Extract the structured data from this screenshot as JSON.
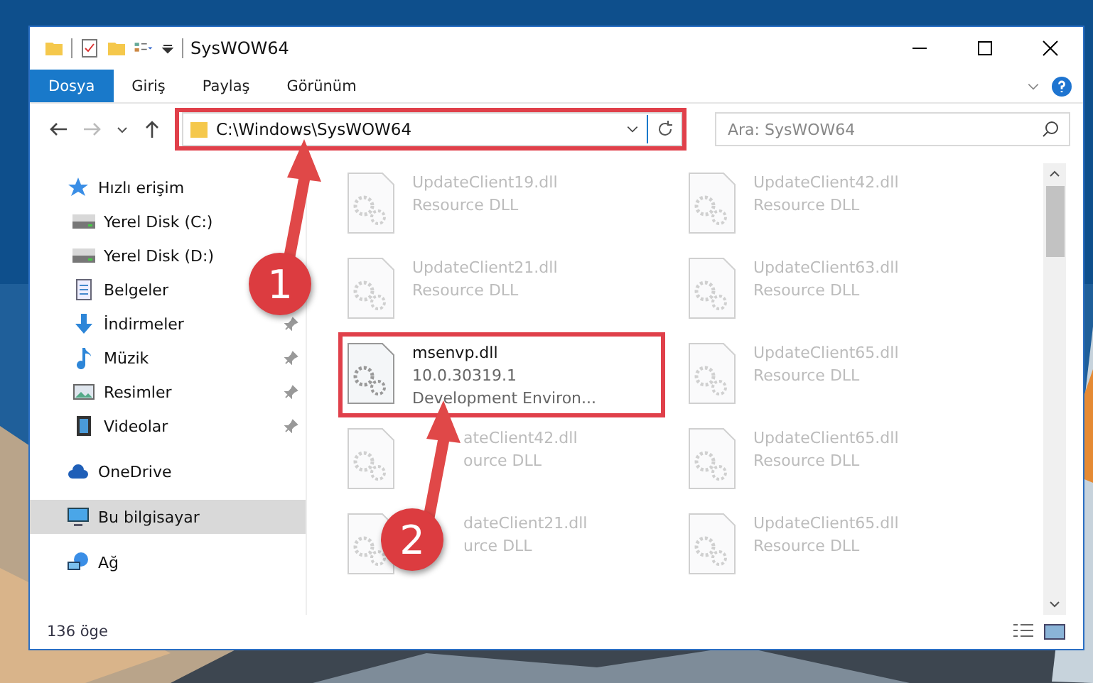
{
  "window": {
    "title": "SysWOW64"
  },
  "ribbon_tabs": [
    {
      "label": "Dosya",
      "selected": true
    },
    {
      "label": "Giriş",
      "selected": false
    },
    {
      "label": "Paylaş",
      "selected": false
    },
    {
      "label": "Görünüm",
      "selected": false
    }
  ],
  "address": {
    "value": "C:\\Windows\\SysWOW64"
  },
  "search": {
    "placeholder": "Ara: SysWOW64"
  },
  "sidebar": {
    "items": [
      {
        "label": "Hızlı erişim",
        "kind": "star",
        "selected": false,
        "children": [
          {
            "label": "Yerel Disk (C:)",
            "kind": "drive",
            "pinned": false,
            "selected": false
          },
          {
            "label": "Yerel Disk (D:)",
            "kind": "drive",
            "pinned": false,
            "selected": false
          },
          {
            "label": "Belgeler",
            "kind": "doc",
            "pinned": false,
            "selected": false
          },
          {
            "label": "İndirmeler",
            "kind": "download",
            "pinned": true,
            "selected": false
          },
          {
            "label": "Müzik",
            "kind": "music",
            "pinned": true,
            "selected": false
          },
          {
            "label": "Resimler",
            "kind": "pictures",
            "pinned": true,
            "selected": false
          },
          {
            "label": "Videolar",
            "kind": "video",
            "pinned": true,
            "selected": false
          }
        ]
      },
      {
        "label": "OneDrive",
        "kind": "cloud",
        "selected": false
      },
      {
        "label": "Bu bilgisayar",
        "kind": "pc",
        "selected": true
      },
      {
        "label": "Ağ",
        "kind": "network",
        "selected": false
      }
    ]
  },
  "files": [
    {
      "name": "UpdateClient19.dll",
      "lines": [
        "Resource DLL"
      ],
      "blurred": true,
      "covered": false
    },
    {
      "name": "UpdateClient42.dll",
      "lines": [
        "Resource DLL"
      ],
      "blurred": true,
      "covered": false
    },
    {
      "name": "UpdateClient21.dll",
      "lines": [
        "Resource DLL"
      ],
      "blurred": true,
      "covered": false
    },
    {
      "name": "UpdateClient63.dll",
      "lines": [
        "Resource DLL"
      ],
      "blurred": true,
      "covered": false
    },
    {
      "name": "msenvp.dll",
      "lines": [
        "10.0.30319.1",
        "Development Environ..."
      ],
      "blurred": false,
      "covered": false
    },
    {
      "name": "UpdateClient65.dll",
      "lines": [
        "Resource DLL"
      ],
      "blurred": true,
      "covered": false
    },
    {
      "name": "ateClient42.dll",
      "lines": [
        "ource DLL"
      ],
      "blurred": true,
      "covered": true
    },
    {
      "name": "UpdateClient65.dll",
      "lines": [
        "Resource DLL"
      ],
      "blurred": true,
      "covered": false
    },
    {
      "name": "dateClient21.dll",
      "lines": [
        "urce DLL"
      ],
      "blurred": true,
      "covered": true
    },
    {
      "name": "UpdateClient65.dll",
      "lines": [
        "Resource DLL"
      ],
      "blurred": true,
      "covered": false
    }
  ],
  "status_bar": {
    "count": "136 öge"
  },
  "annotations": [
    {
      "number": "1"
    },
    {
      "number": "2"
    }
  ]
}
